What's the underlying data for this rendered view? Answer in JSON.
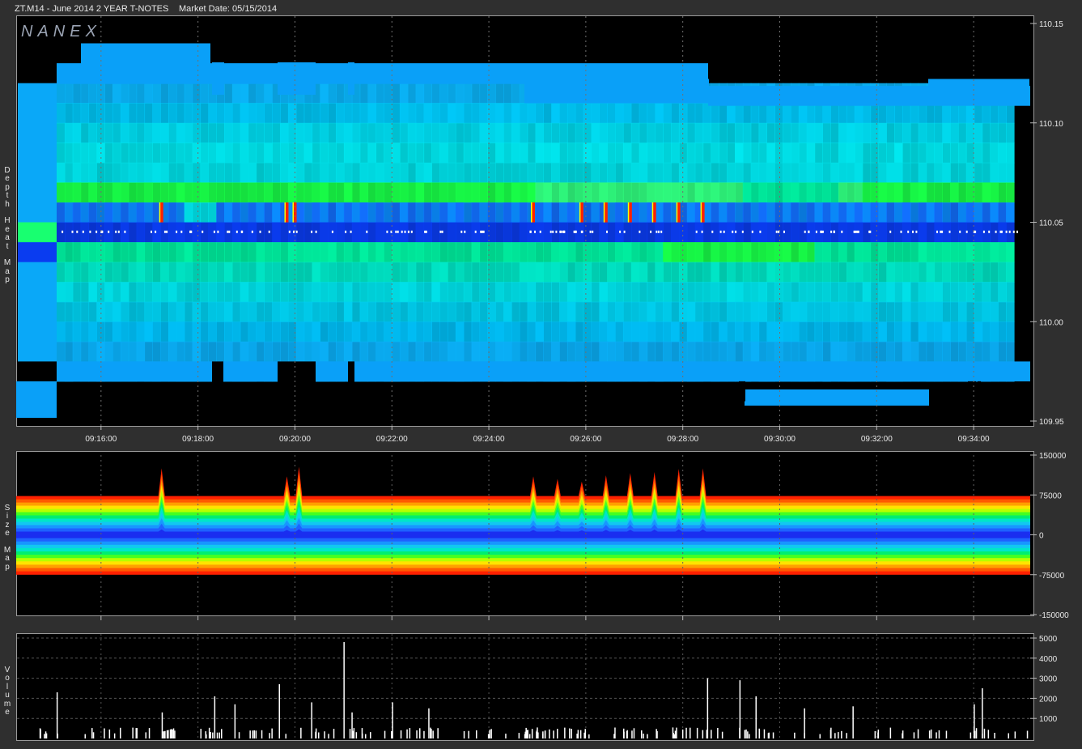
{
  "header": {
    "title": "ZT.M14 - June 2014 2 YEAR T-NOTES",
    "market_date": "Market Date: 05/15/2014"
  },
  "brand": {
    "logo_text": "NANEX"
  },
  "side_labels": {
    "heat": "Depth Heat Map",
    "size": "Size Map",
    "volume": "Volume"
  },
  "chart_data": [
    {
      "type": "heatmap",
      "title": "Depth Heat Map",
      "x_ticks": [
        "09:16:00",
        "09:18:00",
        "09:20:00",
        "09:22:00",
        "09:24:00",
        "09:26:00",
        "09:28:00",
        "09:30:00",
        "09:32:00",
        "09:34:00"
      ],
      "x_range": [
        "09:14:15",
        "09:35:10"
      ],
      "y_ticks": [
        "110.15",
        "110.10",
        "110.05",
        "110.00",
        "109.95"
      ],
      "ylim": [
        109.95,
        110.15
      ],
      "grid": true,
      "colors": {
        "deep": "#0a3cf0",
        "mid": "#0aa8f8",
        "cyan": "#00e8f0",
        "green": "#18ff48",
        "yellow": "#ffff00",
        "red": "#ff2000",
        "empty": "#000000"
      },
      "mid_price_level": 110.045,
      "hot_spikes_time": [
        "09:17:15",
        "09:19:50",
        "09:20:00",
        "09:24:55",
        "09:25:55",
        "09:26:25",
        "09:26:55",
        "09:27:25",
        "09:27:55",
        "09:28:25"
      ]
    },
    {
      "type": "area",
      "title": "Size Map",
      "y_ticks": [
        "150000",
        "75000",
        "0",
        "-75000",
        "-150000"
      ],
      "ylim": [
        -150000,
        150000
      ],
      "grid": true,
      "band_colors": [
        "#1a2ef0",
        "#1e62ff",
        "#1896ff",
        "#12c8f0",
        "#00e6c8",
        "#00ee70",
        "#44ff22",
        "#b8ff00",
        "#ffe400",
        "#ffa000",
        "#ff5a00",
        "#ff2000"
      ],
      "typical_upper": 73000,
      "typical_lower": -75000,
      "spikes": [
        {
          "time": "09:17:15",
          "value": 125000
        },
        {
          "time": "09:19:50",
          "value": 110000
        },
        {
          "time": "09:20:05",
          "value": 128000
        },
        {
          "time": "09:24:55",
          "value": 110000
        },
        {
          "time": "09:25:25",
          "value": 105000
        },
        {
          "time": "09:25:55",
          "value": 100000
        },
        {
          "time": "09:26:25",
          "value": 112000
        },
        {
          "time": "09:26:55",
          "value": 116000
        },
        {
          "time": "09:27:25",
          "value": 118000
        },
        {
          "time": "09:27:55",
          "value": 124000
        },
        {
          "time": "09:28:25",
          "value": 125000
        }
      ]
    },
    {
      "type": "bar",
      "title": "Volume",
      "y_ticks": [
        "5000",
        "4000",
        "3000",
        "2000",
        "1000"
      ],
      "ylim": [
        0,
        5000
      ],
      "grid": true,
      "bar_color": "#ffffff",
      "notable_bars": [
        {
          "time": "09:15:05",
          "value": 2300
        },
        {
          "time": "09:17:15",
          "value": 1300
        },
        {
          "time": "09:18:20",
          "value": 2100
        },
        {
          "time": "09:18:45",
          "value": 1700
        },
        {
          "time": "09:19:40",
          "value": 2700
        },
        {
          "time": "09:20:20",
          "value": 1800
        },
        {
          "time": "09:21:00",
          "value": 4800
        },
        {
          "time": "09:21:10",
          "value": 1300
        },
        {
          "time": "09:22:00",
          "value": 1800
        },
        {
          "time": "09:22:45",
          "value": 1500
        },
        {
          "time": "09:28:30",
          "value": 3000
        },
        {
          "time": "09:29:10",
          "value": 2900
        },
        {
          "time": "09:29:30",
          "value": 2100
        },
        {
          "time": "09:30:30",
          "value": 1500
        },
        {
          "time": "09:31:30",
          "value": 1600
        },
        {
          "time": "09:34:00",
          "value": 1700
        },
        {
          "time": "09:34:10",
          "value": 2500
        }
      ]
    }
  ]
}
